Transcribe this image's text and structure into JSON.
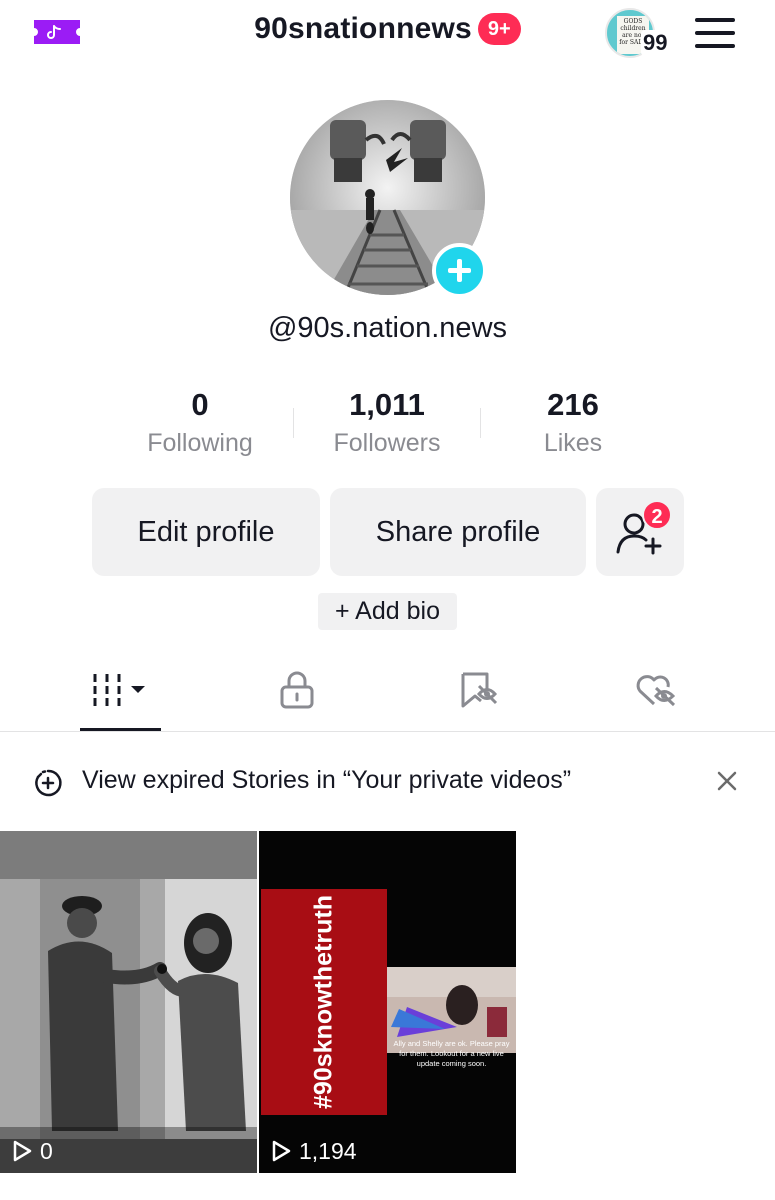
{
  "header": {
    "account_name": "90snationnews",
    "notification_badge": "9+",
    "story_count": "99",
    "story_thumbnail_text": "GODS children are not for SALE",
    "icons": [
      "ticket-icon",
      "menu-icon"
    ]
  },
  "profile": {
    "handle": "@90s.nation.news",
    "avatar_description_icon": "broken-chains-railroad-avatar"
  },
  "stats": {
    "following": {
      "value": "0",
      "label": "Following"
    },
    "followers": {
      "value": "1,011",
      "label": "Followers"
    },
    "likes": {
      "value": "216",
      "label": "Likes"
    }
  },
  "actions": {
    "edit_profile": "Edit profile",
    "share_profile": "Share profile",
    "friend_requests_badge": "2",
    "add_bio": "+ Add bio"
  },
  "tabs": [
    {
      "icon": "videos-grid-icon",
      "active": true
    },
    {
      "icon": "lock-icon",
      "active": false
    },
    {
      "icon": "saved-hidden-icon",
      "active": false
    },
    {
      "icon": "liked-hidden-icon",
      "active": false
    }
  ],
  "banner": {
    "text": "View expired Stories in “Your private videos”"
  },
  "videos": [
    {
      "views": "0"
    },
    {
      "views": "1,194",
      "hashtag": "#90sknowthetruth",
      "caption": "Ally and Shelly are ok. Please pray for them. Lookout for a new live update coming soon."
    }
  ],
  "colors": {
    "accent_red": "#fe2c55",
    "accent_cyan": "#20d5ec",
    "ticket_purple": "#9b1cf5",
    "button_gray": "#f1f1f2"
  }
}
